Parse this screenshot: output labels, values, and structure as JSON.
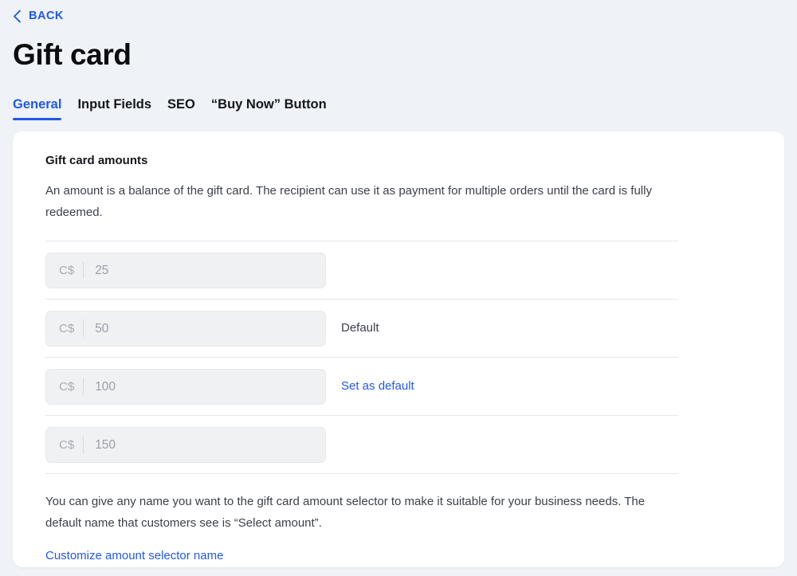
{
  "nav": {
    "back_label": "BACK",
    "back_icon": "chevron-left-icon"
  },
  "header": {
    "title": "Gift card"
  },
  "tabs": [
    {
      "label": "General",
      "active": true
    },
    {
      "label": "Input Fields",
      "active": false
    },
    {
      "label": "SEO",
      "active": false
    },
    {
      "label": "“Buy Now” Button",
      "active": false
    }
  ],
  "section": {
    "title": "Gift card amounts",
    "description": "An amount is a balance of the gift card. The recipient can use it as payment for multiple orders until the card is fully redeemed."
  },
  "amounts": [
    {
      "currency": "C$",
      "value": "25",
      "action_label": "",
      "action_type": "none"
    },
    {
      "currency": "C$",
      "value": "50",
      "action_label": "Default",
      "action_type": "static"
    },
    {
      "currency": "C$",
      "value": "100",
      "action_label": "Set as default",
      "action_type": "link"
    },
    {
      "currency": "C$",
      "value": "150",
      "action_label": "",
      "action_type": "none"
    }
  ],
  "footer": {
    "note": "You can give any name you want to the gift card amount selector to make it suitable for your business needs. The default name that customers see is “Select amount”.",
    "link_label": "Customize amount selector name"
  },
  "colors": {
    "accent": "#2059e6",
    "page_background": "#eff2f6",
    "card_background": "#ffffff",
    "input_background": "#f0f1f3",
    "text_primary": "#14161a",
    "text_secondary": "#3c4149",
    "text_muted": "#9aa0a8",
    "divider": "#e4e7ec"
  }
}
